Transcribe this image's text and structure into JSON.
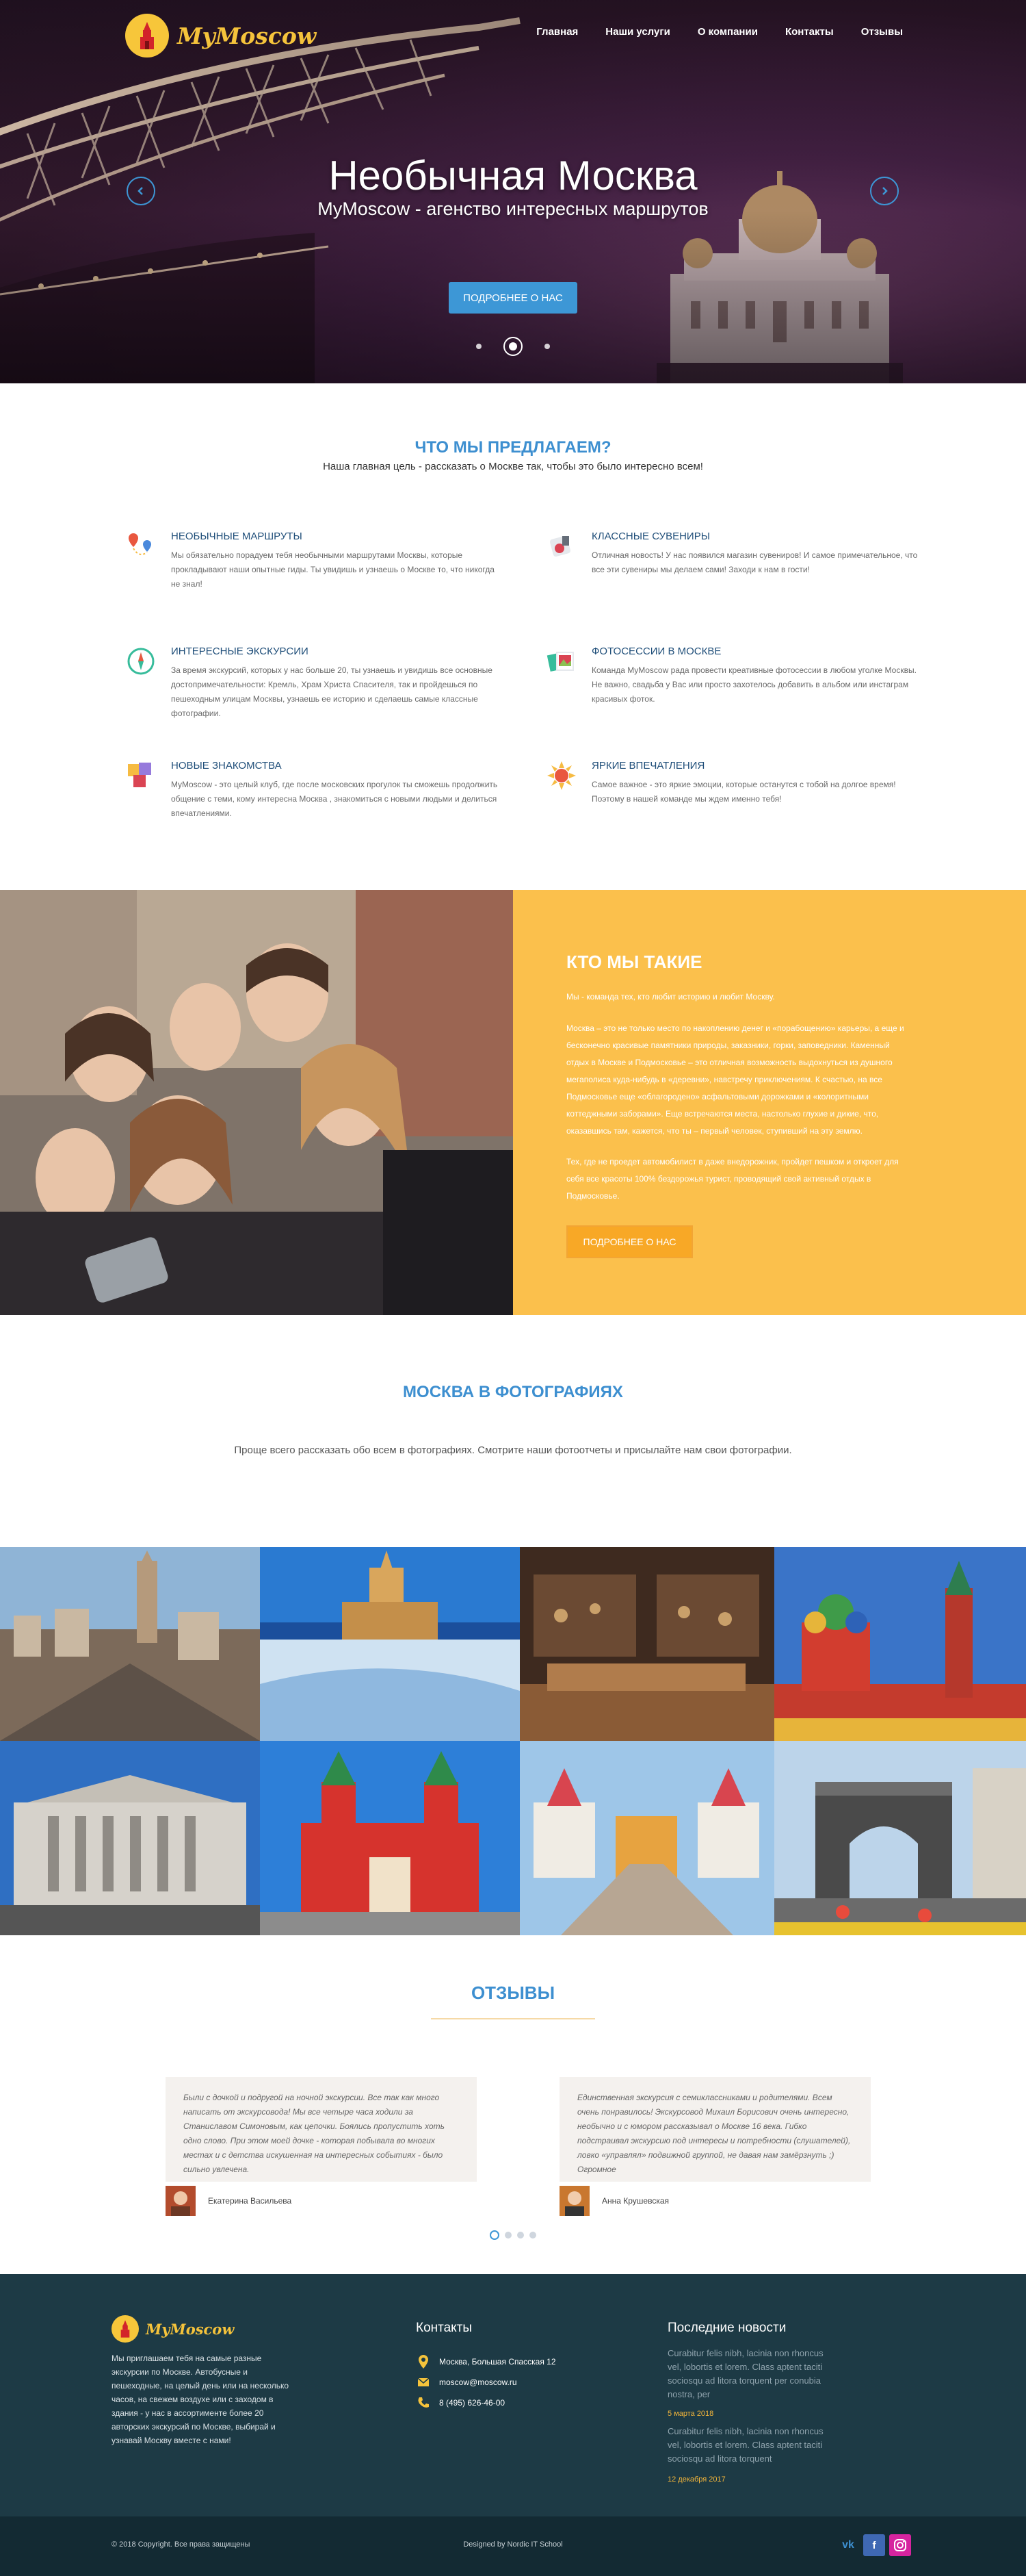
{
  "colors": {
    "accent": "#3d8fd0",
    "yellow": "#fbc04c",
    "orange": "#f8a826",
    "footer": "#1d3a45"
  },
  "header": {
    "logo_text": "MyMoscow",
    "nav": [
      "Главная",
      "Наши услуги",
      "О компании",
      "Контакты",
      "Отзывы"
    ]
  },
  "hero": {
    "title": "Необычная Москва",
    "subtitle": "MyMoscow - агенство интересных маршрутов",
    "button": "ПОДРОБНЕЕ О НАС"
  },
  "services": {
    "title": "ЧТО МЫ ПРЕДЛАГАЕМ?",
    "subtitle": "Наша главная цель - рассказать о Москве так, чтобы это было интересно всем!",
    "items": [
      {
        "icon": "map-pins-icon",
        "title": "НЕОБЫЧНЫЕ МАРШРУТЫ",
        "text": "Мы обязательно порадуем тебя необычными маршрутами Москвы, которые прокладывают наши опытные гиды. Ты увидишь и узнаешь о Москве то, что никогда не знал!"
      },
      {
        "icon": "souvenir-icon",
        "title": "КЛАССНЫЕ СУВЕНИРЫ",
        "text": "Отличная новость! У нас появился магазин сувениров! И самое примечательное, что все эти сувениры мы делаем сами! Заходи к нам в гости!"
      },
      {
        "icon": "compass-icon",
        "title": "ИНТЕРЕСНЫЕ ЭКСКУРСИИ",
        "text": "За время экскурсий, которых у нас больше 20, ты узнаешь и увидишь все основные достопримечательности: Кремль, Храм Христа Спасителя, так и пройдешься по пешеходным улицам Москвы, узнаешь ее историю и сделаешь самые классные фотографии."
      },
      {
        "icon": "photo-icon",
        "title": "ФОТОСЕССИИ В МОСКВЕ",
        "text": "Команда MyMoscow рада провести креативные фотосессии в любом уголке Москвы. Не важно, свадьба у Вас или просто захотелось добавить в альбом или инстаграм красивых фоток."
      },
      {
        "icon": "people-icon",
        "title": "НОВЫЕ ЗНАКОМСТВА",
        "text": "MyMoscow - это целый клуб, где после московских прогулок ты сможешь продолжить общение с теми, кому интересна Москва , знакомиться с новыми людьми и делиться впечатлениями."
      },
      {
        "icon": "sun-icon",
        "title": "ЯРКИЕ ВПЕЧАТЛЕНИЯ",
        "text": "Самое важное - это яркие эмоции, которые останутся с тобой на долгое время! Поэтому в нашей команде мы ждем именно тебя!"
      }
    ]
  },
  "about": {
    "title": "КТО МЫ ТАКИЕ",
    "p1": "Мы - команда тех, кто любит историю и любит Москву.",
    "p2": "Москва – это не только место по накоплению денег и «порабощению» карьеры, а еще и бесконечно красивые памятники природы, заказники, горки, заповедники. Каменный отдых в Москве и Подмосковье – это отличная возможность выдохнуться из душного мегаполиса куда-нибудь в «деревни», навстречу приключениям. К счастью, на все Подмосковье еще «облагородено» асфальтовыми дорожками и «колоритными коттеджными заборами». Еще встречаются места, настолько глухие и дикие, что, оказавшись там, кажется, что ты – первый человек, ступивший на эту землю.",
    "p3": "Тех, где не проедет автомобилист в даже внедорожник, пройдет пешком и откроет для себя все красоты 100% бездорожья турист, проводящий свой активный отдых в Подмосковье.",
    "button": "ПОДРОБНЕЕ О НАС"
  },
  "photos": {
    "title": "МОСКВА В ФОТОГРАФИЯХ",
    "subtitle": "Проще всего рассказать обо всем в фотографиях. Смотрите наши фотоотчеты и присылайте нам свои фотографии."
  },
  "reviews": {
    "title": "ОТЗЫВЫ",
    "items": [
      {
        "text": "Были с дочкой и подругой на ночной экскурсии. Все так как много написать от экскурсовода! Мы все четыре часа ходили за Станиславом Симоновым, как цепочки. Боялись пропустить хоть одно слово. При этом моей дочке - которая побывала во многих местах и с детства искушенная на интересных событиях - было сильно увлечена.",
        "author": "Екатерина Васильева"
      },
      {
        "text": "Единственная экскурсия с семиклассниками и родителями. Всем очень понравилось! Экскурсовод Михаил Борисович очень интересно, необычно и с юмором рассказывал о Москве 16 века. Гибко подстраивал экскурсию под интересы и потребности (слушателей), ловко «управлял» подвижной группой, не давая нам замёрзнуть ;) Огромное",
        "author": "Анна Крушевская"
      }
    ]
  },
  "footer": {
    "logo_text": "MyMoscow",
    "about": "Мы приглашаем тебя на самые разные экскурсии по Москве. Автобусные и пешеходные, на целый день или на несколько часов, на свежем воздухе или с заходом в здания - у нас в ассортименте более 20 авторских экскурсий по Москве, выбирай и узнавай Москву вместе с нами!",
    "contacts_title": "Контакты",
    "address": "Москва, Большая Спасская 12",
    "email": "moscow@moscow.ru",
    "phone": "8 (495) 626-46-00",
    "news_title": "Последние новости",
    "news": [
      {
        "text": "Curabitur felis nibh, lacinia non rhoncus vel, lobortis et lorem. Class aptent taciti sociosqu ad litora torquent per conubia nostra, per",
        "date": "5 марта 2018"
      },
      {
        "text": "Curabitur felis nibh, lacinia non rhoncus vel, lobortis et lorem. Class aptent taciti sociosqu ad litora torquent",
        "date": "12 декабря 2017"
      }
    ],
    "copyright": "© 2018 Copyright. Все права защищены",
    "designed": "Designed by Nordic IT School",
    "socials": [
      "vk",
      "f"
    ]
  }
}
